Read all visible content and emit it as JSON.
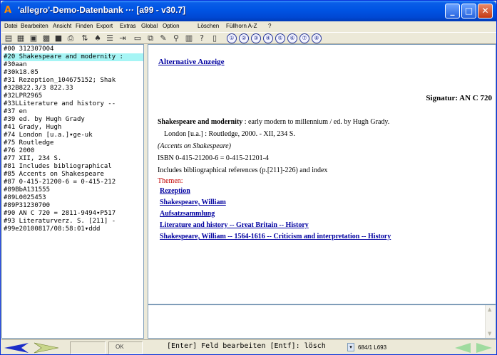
{
  "window": {
    "title": "'allegro'-Demo-Datenbank ··· [a99 - v30.7]",
    "minimize": "_",
    "maximize": "□",
    "close": "✕"
  },
  "menu": [
    "Datei",
    "Bearbeiten",
    "Ansicht",
    "Finden",
    "Export",
    "Extras",
    "Global",
    "Option",
    "Löschen",
    "Füllhorn A-Z",
    "?"
  ],
  "toolbar": {
    "numbers": [
      "①",
      "②",
      "③",
      "④",
      "⑤",
      "⑥",
      "⑦",
      "⑧"
    ]
  },
  "record": {
    "lines": [
      "#00 312307004",
      "#20 Shakespeare and modernity :",
      "#30aan",
      "#30k18.05",
      "#31 Rezeption_104675152; Shak",
      "#32B822.3/3 822.33",
      "#32LPR2965",
      "#33LLiterature and history --",
      "#37 en",
      "#39 ed. by Hugh Grady",
      "#41 Grady, Hugh",
      "#74 London [u.a.]▾ge-uk",
      "#75 Routledge",
      "#76 2000",
      "#77 XII, 234 S.",
      "#81 Includes bibliographical",
      "#85 Accents on Shakespeare",
      "#87 0-415-21200-6 = 0-415-212",
      "#89BbA131555",
      "#89L0025453",
      "#89P31230700",
      "#90 AN C 720 = 2811-9494▾P517",
      "#93 Literaturverz. S. [211] -",
      "#99e20100817/08:58:01▾ddd"
    ],
    "selected_index": 1
  },
  "display": {
    "alt_link": "Alternative Anzeige",
    "signatur": "Signatur: AN C 720",
    "title_bold": "Shakespeare and modernity",
    "title_rest": " : early modern to millennium / ed. by Hugh Grady.",
    "imprint": "London [u.a.] : Routledge, 2000. - XII, 234 S.",
    "series": "(Accents on Shakespeare)",
    "isbn": "ISBN 0-415-21200-6 = 0-415-21201-4",
    "note": "Includes bibliographical references (p.[211]-226) and index",
    "themen_label": "Themen:",
    "subjects": [
      "Rezeption",
      "Shakespeare, William",
      "Aufsatzsammlung",
      "Literature and history -- Great Britain -- History",
      "Shakespeare, William -- 1564-1616 -- Criticism and interpretation -- History"
    ]
  },
  "status": {
    "ok": "OK",
    "hint": "[Enter] Feld bearbeiten   [Entf]: lösch",
    "combo_arrow": "▾",
    "position": "684/1 L693"
  }
}
